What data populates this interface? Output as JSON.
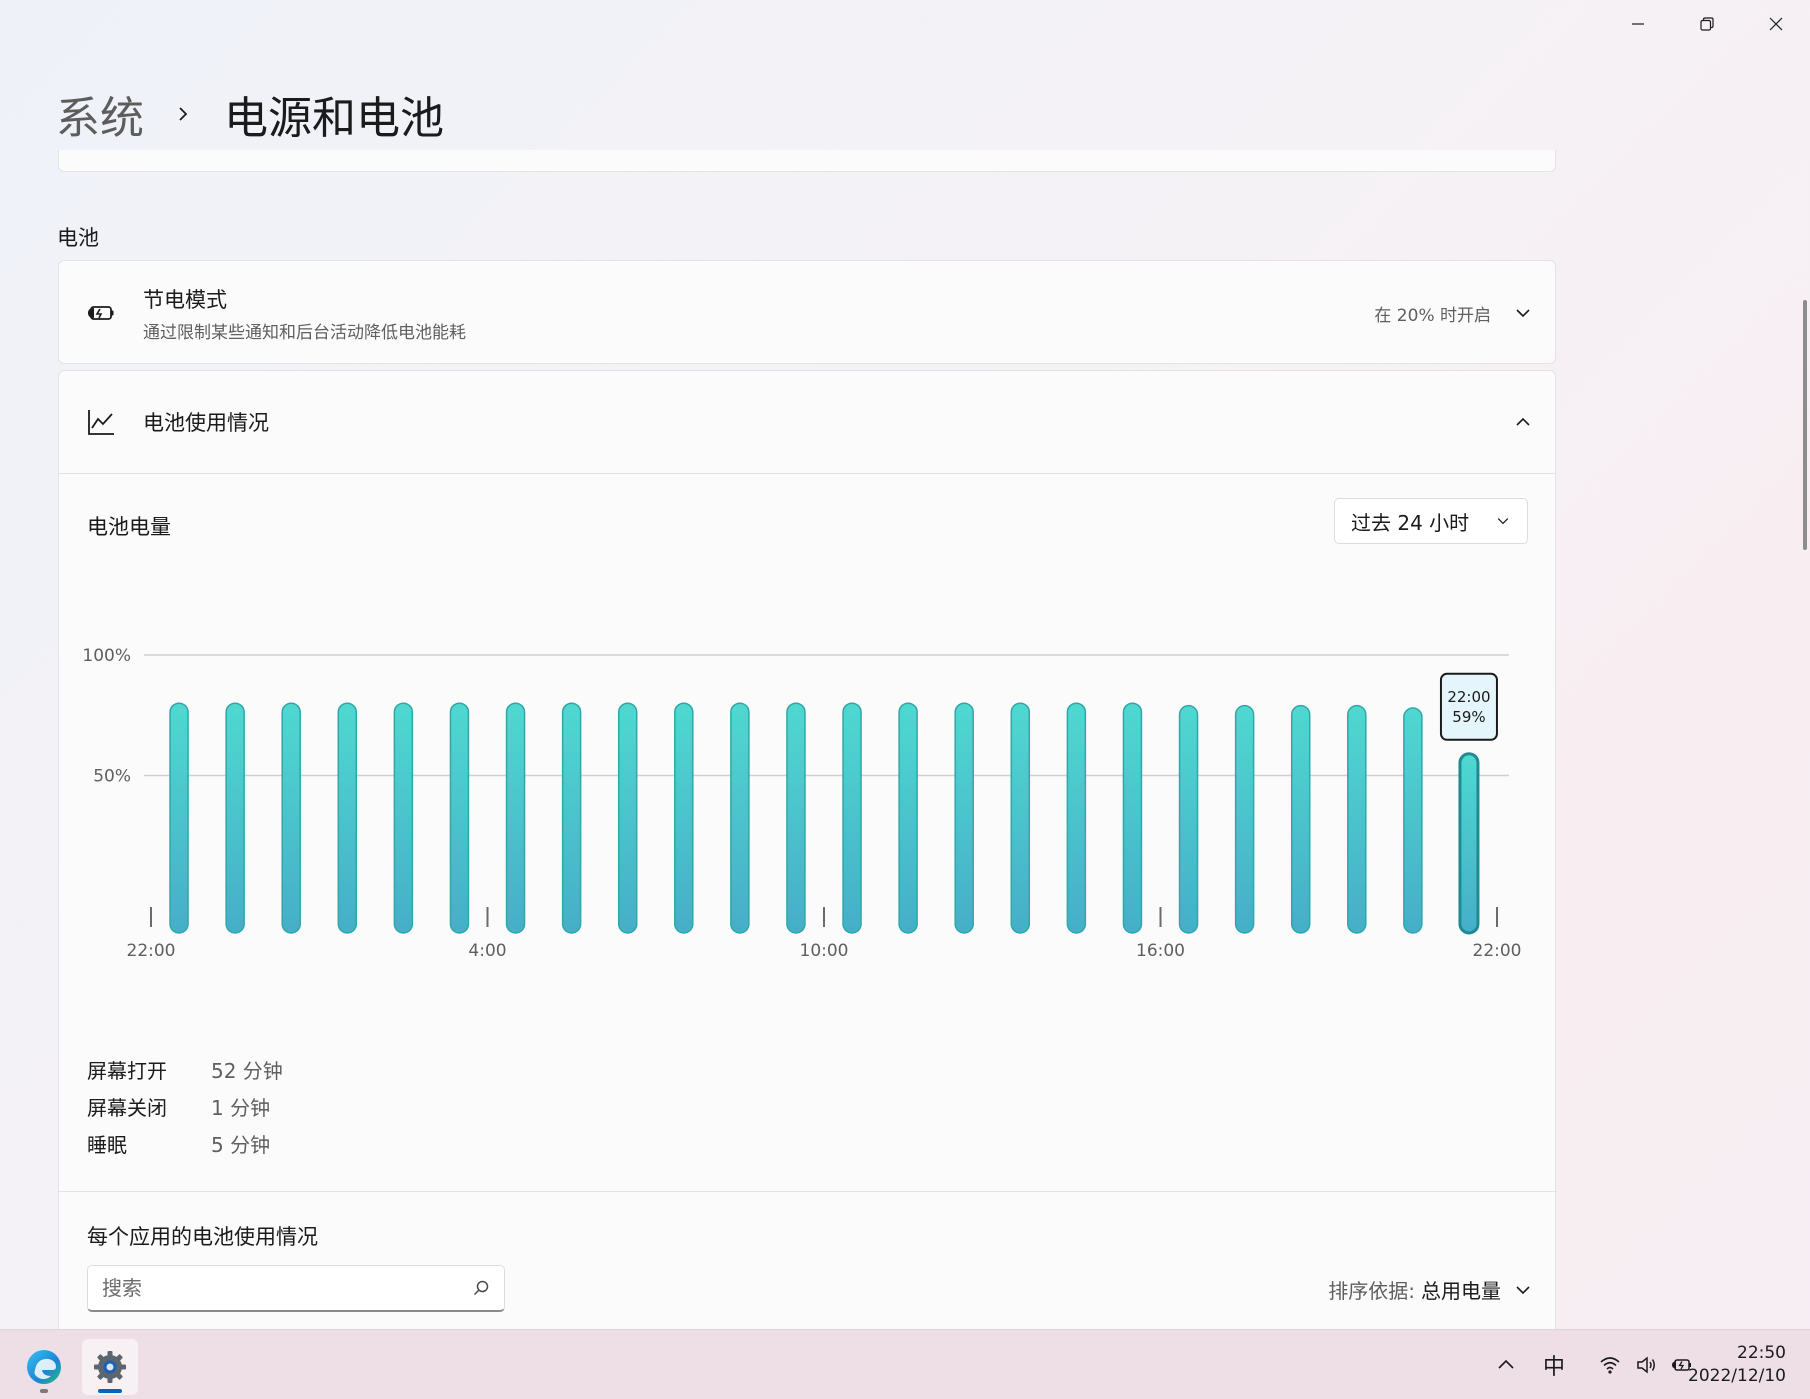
{
  "window": {
    "minimize_icon": "minimize-icon",
    "restore_icon": "restore-icon",
    "close_icon": "close-icon"
  },
  "breadcrumb": {
    "parent": "系统",
    "current": "电源和电池"
  },
  "battery_section": {
    "title": "电池",
    "battery_saver": {
      "icon": "battery-saver-icon",
      "title": "节电模式",
      "subtitle": "通过限制某些通知和后台活动降低电池能耗",
      "value": "在 20% 时开启"
    },
    "usage": {
      "icon": "line-chart-icon",
      "title": "电池使用情况",
      "level_title": "电池电量",
      "range_select": "过去 24 小时",
      "stats": [
        {
          "label": "屏幕打开",
          "value": "52 分钟"
        },
        {
          "label": "屏幕关闭",
          "value": "1 分钟"
        },
        {
          "label": "睡眠",
          "value": "5 分钟"
        }
      ],
      "app_usage_title": "每个应用的电池使用情况",
      "search_placeholder": "搜索",
      "sort_label": "排序依据:",
      "sort_value": "总用电量"
    }
  },
  "chart_data": {
    "type": "bar",
    "y_tick_labels": [
      "100%",
      "50%"
    ],
    "x_tick_labels": [
      "22:00",
      "4:00",
      "10:00",
      "16:00",
      "22:00"
    ],
    "ylim": [
      0,
      100
    ],
    "values": [
      80,
      80,
      80,
      80,
      80,
      80,
      80,
      80,
      80,
      80,
      80,
      80,
      80,
      80,
      80,
      80,
      80,
      80,
      79,
      79,
      79,
      79,
      78,
      59
    ],
    "bar_color": "#3fc6c6",
    "selected_index": 23,
    "tooltip": {
      "time": "22:00",
      "value": "59%"
    }
  },
  "taskbar": {
    "apps": [
      {
        "name": "edge-icon"
      },
      {
        "name": "settings-icon",
        "active": true
      }
    ],
    "tray": {
      "chevron": "chevron-up-icon",
      "ime": "中",
      "wifi": "wifi-icon",
      "volume": "volume-icon",
      "battery": "battery-charging-icon"
    },
    "time": "22:50",
    "date": "2022/12/10",
    "accent": "#0067c0"
  }
}
